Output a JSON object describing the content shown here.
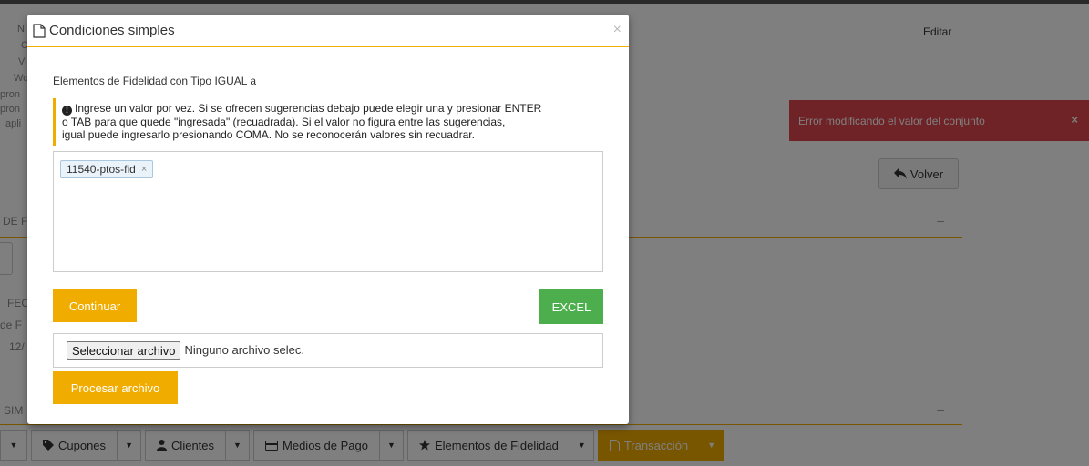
{
  "background": {
    "edit_link": "Editar",
    "fragments": [
      "N",
      "C",
      "Vi",
      "Wo",
      "pron",
      "pron",
      "apli",
      "DE F",
      "FEC",
      "de F",
      "12/",
      "SIM"
    ],
    "volver_label": "Volver",
    "section_collapse": "–"
  },
  "toast": {
    "message": "Error modificando el valor del conjunto",
    "close": "×",
    "color": "#e0474c"
  },
  "toolbar": {
    "items": [
      {
        "label": "",
        "icon": "none"
      },
      {
        "label": "Cupones",
        "icon": "tag-icon"
      },
      {
        "label": "Clientes",
        "icon": "user-icon"
      },
      {
        "label": "Medios de Pago",
        "icon": "credit-card-icon"
      },
      {
        "label": "Elementos de Fidelidad",
        "icon": "star-icon"
      },
      {
        "label": "Transacción",
        "icon": "file-icon"
      }
    ],
    "caret": "▼",
    "active_color": "#f0ad00"
  },
  "modal": {
    "title": "Condiciones simples",
    "close": "×",
    "condition_label": "Elementos de Fidelidad con Tipo IGUAL a",
    "info_text_line1": "Ingrese un valor por vez. Si se ofrecen sugerencias debajo puede elegir una y presionar ENTER",
    "info_text_line2": "o TAB para que quede \"ingresada\" (recuadrada). Si el valor no figura entre las sugerencias,",
    "info_text_line3": "igual puede ingresarlo presionando COMA. No se reconocerán valores sin recuadrar.",
    "info_icon": "!",
    "tags": [
      {
        "label": "11540-ptos-fid",
        "remove": "×"
      }
    ],
    "continue_label": "Continuar",
    "excel_label": "EXCEL",
    "file_button_label": "Seleccionar archivo",
    "file_status": "Ninguno archivo selec.",
    "process_label": "Procesar archivo",
    "accent_color": "#f0ad00",
    "excel_color": "#4cae4c"
  }
}
